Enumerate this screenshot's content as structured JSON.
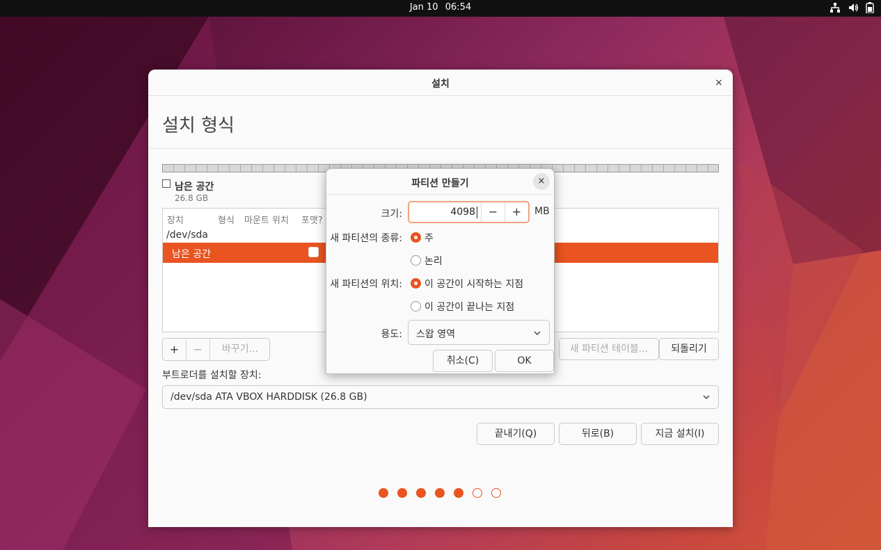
{
  "topbar": {
    "date": "Jan 10",
    "time": "06:54"
  },
  "window": {
    "title": "설치",
    "close_icon": "×",
    "heading": "설치 형식",
    "free_space": {
      "label": "남은 공간",
      "size": "26.8 GB"
    },
    "table": {
      "headers": [
        "장치",
        "형식",
        "마운트 위치",
        "포맷?"
      ],
      "device": "/dev/sda",
      "selected_row": "남은 공간"
    },
    "tools": {
      "add": "+",
      "remove": "−",
      "change": "바꾸기..."
    },
    "new_table_button": "새 파티션 테이블...",
    "revert_button": "되돌리기",
    "bootloader": {
      "label": "부트로더를 설치할 장치:",
      "value": "/dev/sda ATA VBOX HARDDISK (26.8 GB)"
    },
    "buttons": {
      "quit": "끝내기(Q)",
      "back": "뒤로(B)",
      "install": "지금 설치(I)"
    },
    "progress": {
      "total": 7,
      "completed": 5
    }
  },
  "dialog": {
    "title": "파티션 만들기",
    "close_icon": "×",
    "size": {
      "label": "크기:",
      "value": "4098",
      "minus": "−",
      "plus": "+",
      "unit": "MB"
    },
    "type": {
      "label": "새 파티션의 종류:",
      "options": [
        "주",
        "논리"
      ],
      "selected": 0
    },
    "location": {
      "label": "새 파티션의 위치:",
      "options": [
        "이 공간이 시작하는 지점",
        "이 공간이 끝나는 지점"
      ],
      "selected": 0
    },
    "use": {
      "label": "용도:",
      "value": "스왑 영역"
    },
    "cancel": "취소(C)",
    "ok": "OK"
  },
  "colors": {
    "accent": "#e95420",
    "topbar": "#111111"
  }
}
